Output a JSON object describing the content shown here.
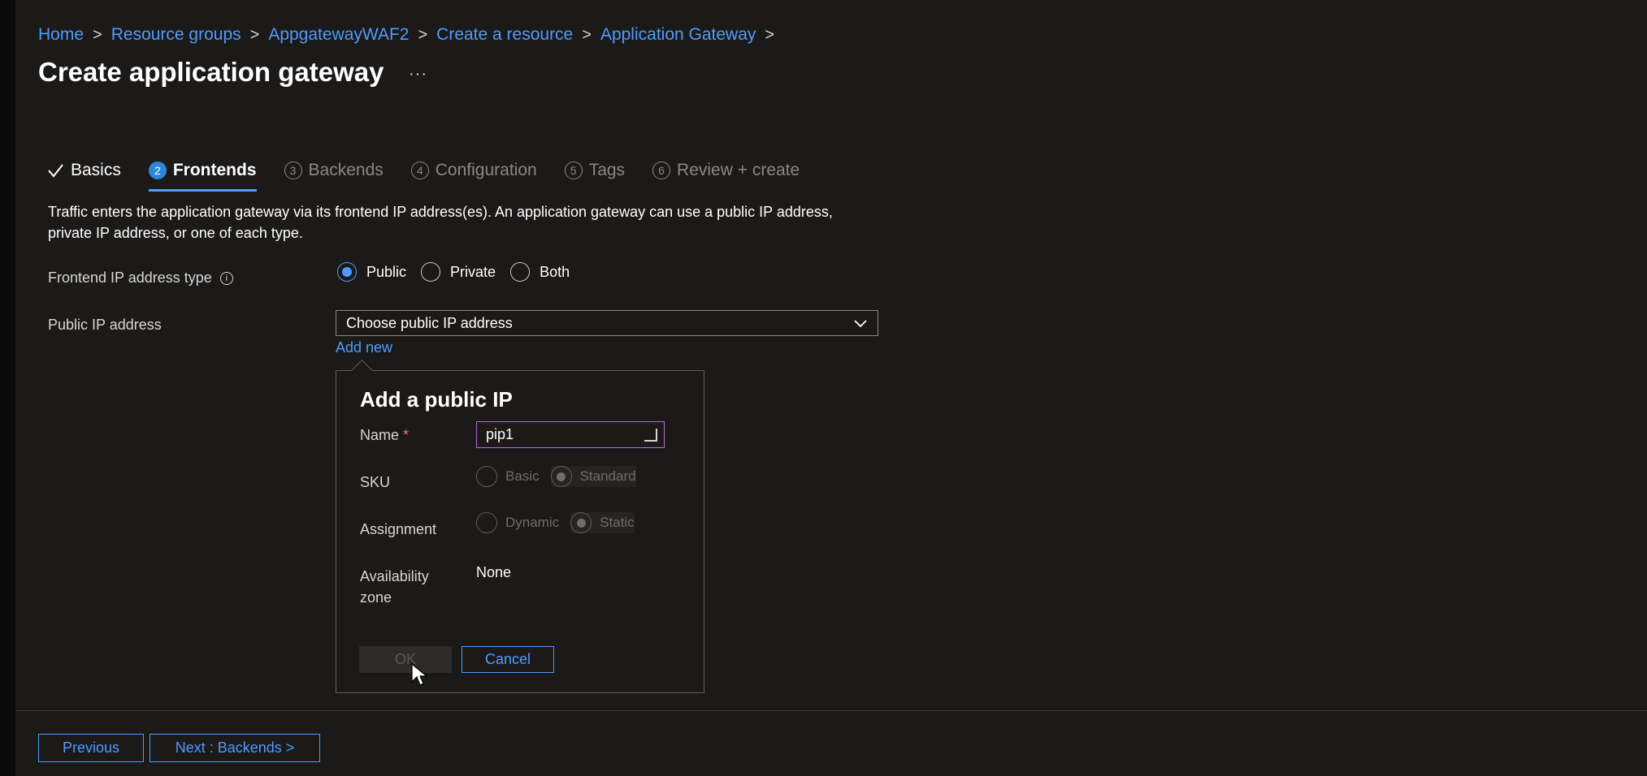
{
  "breadcrumb": {
    "items": [
      "Home",
      "Resource groups",
      "AppgatewayWAF2",
      "Create a resource",
      "Application Gateway"
    ],
    "separator": ">"
  },
  "page": {
    "title": "Create application gateway",
    "more": "···"
  },
  "tabs": [
    {
      "num": "",
      "label": "Basics",
      "state": "done"
    },
    {
      "num": "2",
      "label": "Frontends",
      "state": "active"
    },
    {
      "num": "3",
      "label": "Backends",
      "state": "todo"
    },
    {
      "num": "4",
      "label": "Configuration",
      "state": "todo"
    },
    {
      "num": "5",
      "label": "Tags",
      "state": "todo"
    },
    {
      "num": "6",
      "label": "Review + create",
      "state": "todo"
    }
  ],
  "description": "Traffic enters the application gateway via its frontend IP address(es). An application gateway can use a public IP address, private IP address, or one of each type.",
  "frontend_type": {
    "label": "Frontend IP address type",
    "info_icon": "i",
    "options": [
      "Public",
      "Private",
      "Both"
    ],
    "selected": "Public"
  },
  "public_ip": {
    "label": "Public IP address",
    "placeholder": "Choose public IP address",
    "add_new": "Add new"
  },
  "callout": {
    "title": "Add a public IP",
    "name_label": "Name",
    "required_mark": "*",
    "name_value": "pip1",
    "sku_label": "SKU",
    "sku_options": [
      "Basic",
      "Standard"
    ],
    "sku_selected": "Standard",
    "assignment_label": "Assignment",
    "assignment_options": [
      "Dynamic",
      "Static"
    ],
    "assignment_selected": "Static",
    "zone_label_line1": "Availability",
    "zone_label_line2": "zone",
    "zone_value": "None",
    "ok": "OK",
    "cancel": "Cancel"
  },
  "footer": {
    "previous": "Previous",
    "next": "Next : Backends >"
  },
  "colors": {
    "accent": "#4f9bff",
    "background": "#1b1a19",
    "active_step": "#2b88d8"
  }
}
